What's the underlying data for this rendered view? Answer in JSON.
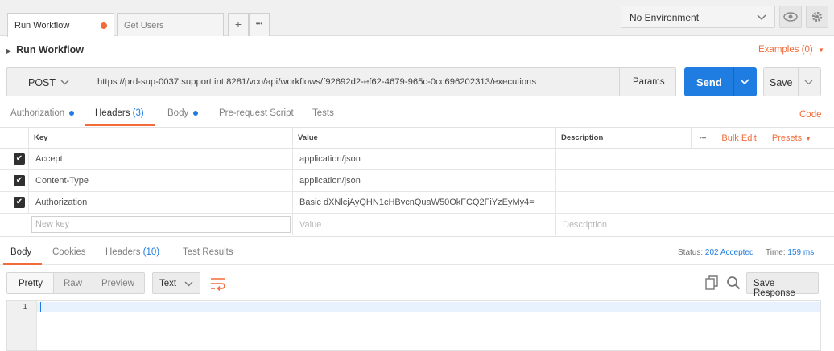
{
  "tabs": [
    {
      "label": "Run Workflow",
      "active": true,
      "modified": true
    },
    {
      "label": "Get Users",
      "active": false,
      "modified": false
    }
  ],
  "tab_actions": {
    "add": "+",
    "more": "•••"
  },
  "environment": {
    "selected": "No Environment"
  },
  "request": {
    "name": "Run Workflow",
    "examples_label": "Examples (0)",
    "method": "POST",
    "url": "https://prd-sup-0037.support.int:8281/vco/api/workflows/f92692d2-ef62-4679-965c-0cc696202313/executions",
    "params_label": "Params",
    "send_label": "Send",
    "save_label": "Save"
  },
  "request_tabs": [
    {
      "label": "Authorization",
      "dot": true
    },
    {
      "label": "Headers",
      "count": "(3)",
      "active": true
    },
    {
      "label": "Body",
      "dot": true
    },
    {
      "label": "Pre-request Script"
    },
    {
      "label": "Tests"
    }
  ],
  "code_label": "Code",
  "headers_table": {
    "columns": [
      "Key",
      "Value",
      "Description"
    ],
    "more": "•••",
    "bulk_edit": "Bulk Edit",
    "presets": "Presets",
    "rows": [
      {
        "key": "Accept",
        "value": "application/json",
        "description": "",
        "checked": true
      },
      {
        "key": "Content-Type",
        "value": "application/json",
        "description": "",
        "checked": true
      },
      {
        "key": "Authorization",
        "value": "Basic dXNlcjAyQHN1cHBvcnQuaW50OkFCQ2FiYzEyMy4=",
        "description": "",
        "checked": true
      }
    ],
    "placeholders": {
      "key": "New key",
      "value": "Value",
      "description": "Description"
    }
  },
  "response": {
    "tabs": [
      {
        "label": "Body",
        "active": true
      },
      {
        "label": "Cookies"
      },
      {
        "label": "Headers",
        "count": "(10)"
      },
      {
        "label": "Test Results"
      }
    ],
    "status_label": "Status:",
    "status_value": "202 Accepted",
    "time_label": "Time:",
    "time_value": "159 ms",
    "formats": [
      "Pretty",
      "Raw",
      "Preview"
    ],
    "type": "Text",
    "save_label": "Save Response",
    "line_number": "1"
  },
  "colors": {
    "accent": "#f26b3a",
    "primary": "#1f7ce0",
    "status_dot_orange": "#f26b3a",
    "status_dot_blue": "#1f7ce0"
  }
}
